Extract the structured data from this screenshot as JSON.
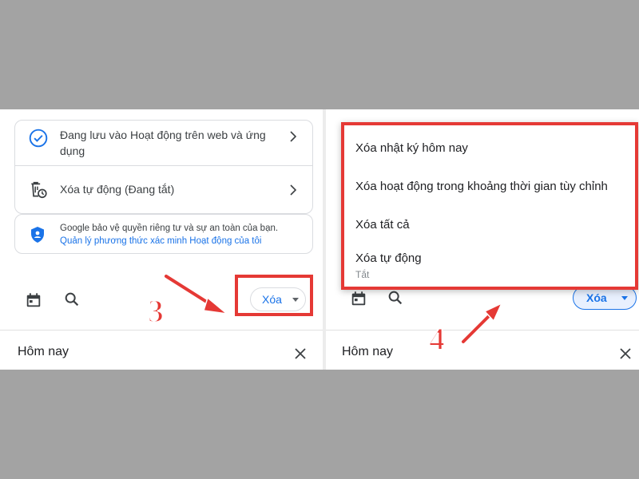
{
  "left": {
    "activity_items": [
      {
        "label": "Đang lưu vào Hoạt động trên web và ứng dụng"
      },
      {
        "label": "Xóa tự động (Đang tắt)"
      }
    ],
    "privacy": {
      "text": "Google bảo vệ quyền riêng tư và sự an toàn của bạn.",
      "link": "Quản lý phương thức xác minh Hoạt động của tôi"
    },
    "delete_button": "Xóa",
    "section_title": "Hôm nay",
    "step_number": "3"
  },
  "right": {
    "menu_items": [
      {
        "label": "Xóa nhật ký hôm nay"
      },
      {
        "label": "Xóa hoạt động trong khoảng thời gian tùy chỉnh"
      },
      {
        "label": "Xóa tất cả"
      },
      {
        "label": "Xóa tự động",
        "sub": "Tắt"
      }
    ],
    "delete_button": "Xóa",
    "section_title": "Hôm nay",
    "step_number": "4"
  },
  "colors": {
    "accent": "#1a73e8",
    "highlight": "#e53935",
    "background": "#a3a3a3"
  },
  "icons": [
    "check-circle-icon",
    "chevron-right-icon",
    "auto-delete-icon",
    "shield-icon",
    "calendar-icon",
    "search-icon",
    "close-icon",
    "caret-down-icon",
    "arrow-icon"
  ]
}
